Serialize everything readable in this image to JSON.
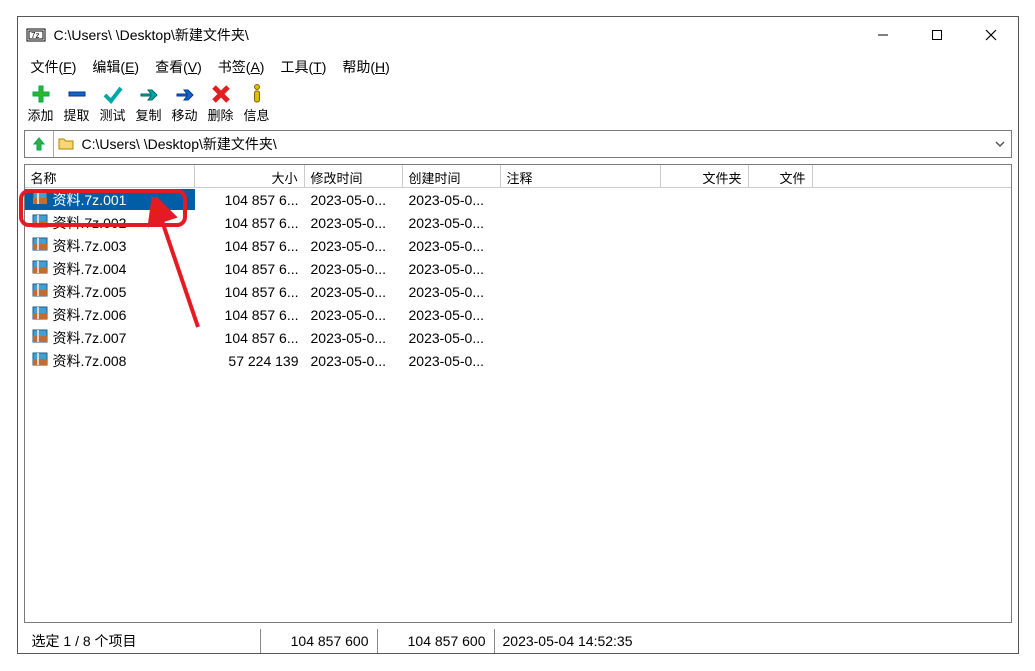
{
  "window": {
    "title": "C:\\Users\\              \\Desktop\\新建文件夹\\"
  },
  "menu": {
    "file": {
      "label": "文件",
      "key": "F"
    },
    "edit": {
      "label": "编辑",
      "key": "E"
    },
    "view": {
      "label": "查看",
      "key": "V"
    },
    "bookmarks": {
      "label": "书签",
      "key": "A"
    },
    "tools": {
      "label": "工具",
      "key": "T"
    },
    "help": {
      "label": "帮助",
      "key": "H"
    }
  },
  "toolbar": {
    "add": "添加",
    "extract": "提取",
    "test": "测试",
    "copy": "复制",
    "move": "移动",
    "delete": "删除",
    "info": "信息"
  },
  "address": {
    "path": "C:\\Users\\              \\Desktop\\新建文件夹\\"
  },
  "columns": {
    "name": "名称",
    "size": "大小",
    "modified": "修改时间",
    "created": "创建时间",
    "comment": "注释",
    "folders": "文件夹",
    "files": "文件"
  },
  "files": [
    {
      "name": "资料.7z.001",
      "size": "104 857 6...",
      "modified": "2023-05-0...",
      "created": "2023-05-0...",
      "selected": true
    },
    {
      "name": "资料.7z.002",
      "size": "104 857 6...",
      "modified": "2023-05-0...",
      "created": "2023-05-0..."
    },
    {
      "name": "资料.7z.003",
      "size": "104 857 6...",
      "modified": "2023-05-0...",
      "created": "2023-05-0..."
    },
    {
      "name": "资料.7z.004",
      "size": "104 857 6...",
      "modified": "2023-05-0...",
      "created": "2023-05-0..."
    },
    {
      "name": "资料.7z.005",
      "size": "104 857 6...",
      "modified": "2023-05-0...",
      "created": "2023-05-0..."
    },
    {
      "name": "资料.7z.006",
      "size": "104 857 6...",
      "modified": "2023-05-0...",
      "created": "2023-05-0..."
    },
    {
      "name": "资料.7z.007",
      "size": "104 857 6...",
      "modified": "2023-05-0...",
      "created": "2023-05-0..."
    },
    {
      "name": "资料.7z.008",
      "size": "57 224 139",
      "modified": "2023-05-0...",
      "created": "2023-05-0..."
    }
  ],
  "status": {
    "selected": "选定 1 / 8 个项目",
    "size1": "104 857 600",
    "size2": "104 857 600",
    "time": "2023-05-04 14:52:35"
  }
}
